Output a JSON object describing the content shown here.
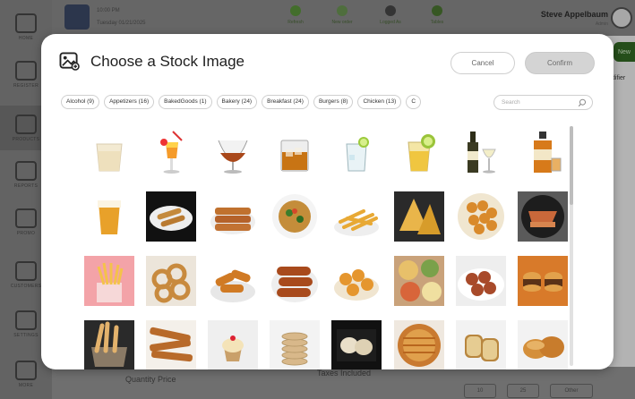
{
  "background": {
    "sidebar_items": [
      {
        "label": "HOME",
        "icon": "home-icon"
      },
      {
        "label": "REGISTER",
        "icon": "register-icon"
      },
      {
        "label": "PRODUCTS",
        "icon": "products-icon"
      },
      {
        "label": "REPORTS",
        "icon": "reports-icon"
      },
      {
        "label": "PROMO",
        "icon": "promo-icon"
      },
      {
        "label": "CUSTOMERS",
        "icon": "customers-icon"
      },
      {
        "label": "SETTINGS",
        "icon": "settings-icon"
      },
      {
        "label": "MORE",
        "icon": "more-icon"
      }
    ],
    "top_line_1": "10:00 PM",
    "top_line_2": "Tuesday 01/21/2025",
    "top_buttons": [
      {
        "label": "Refresh",
        "icon": "refresh-icon",
        "color": "#4e8a2e"
      },
      {
        "label": "New order",
        "icon": "new-order-icon",
        "color": "#5f8a46"
      },
      {
        "label": "Logged As",
        "icon": "user-icon",
        "color": "#3a3a3a"
      },
      {
        "label": "Tables",
        "icon": "tables-icon",
        "color": "#3d6a23"
      }
    ],
    "user_name": "Steve Appelbaum",
    "user_role": "Admin",
    "right_button": "New",
    "right_modifier": "difier",
    "quantity_price_label": "Quantity Price",
    "taxes_label": "Taxes Included",
    "bottom_pills": [
      "10",
      "25",
      "Other"
    ]
  },
  "modal": {
    "title": "Choose a Stock Image",
    "cancel_label": "Cancel",
    "confirm_label": "Confirm",
    "search_placeholder": "Search",
    "categories": [
      "Alcohol (9)",
      "Appetizers (16)",
      "BakedGoods (1)",
      "Bakery (24)",
      "Breakfast (24)",
      "Burgers (8)",
      "Chicken (13)",
      "C"
    ],
    "images": [
      {
        "name": "cocktail-milky",
        "row": "alcohol"
      },
      {
        "name": "cocktail-tropical",
        "row": "alcohol"
      },
      {
        "name": "brandy-snifter",
        "row": "alcohol"
      },
      {
        "name": "whiskey-rocks",
        "row": "alcohol"
      },
      {
        "name": "gin-tonic-lime",
        "row": "alcohol"
      },
      {
        "name": "tequila-shot",
        "row": "alcohol"
      },
      {
        "name": "wine-bottle-glass",
        "row": "alcohol"
      },
      {
        "name": "whiskey-bottle",
        "row": "alcohol"
      },
      {
        "name": "beer-glass",
        "row": "appetizers"
      },
      {
        "name": "spring-rolls",
        "row": "appetizers"
      },
      {
        "name": "mozzarella-sticks",
        "row": "appetizers"
      },
      {
        "name": "nachos-plate",
        "row": "appetizers"
      },
      {
        "name": "french-fries",
        "row": "appetizers"
      },
      {
        "name": "samosas",
        "row": "appetizers"
      },
      {
        "name": "fried-bites-plate",
        "row": "appetizers"
      },
      {
        "name": "meat-pan",
        "row": "appetizers"
      },
      {
        "name": "fries-pink-box",
        "row": "appetizers"
      },
      {
        "name": "onion-rings",
        "row": "appetizers"
      },
      {
        "name": "fried-chicken-fingers",
        "row": "appetizers"
      },
      {
        "name": "sausage-rolls",
        "row": "appetizers"
      },
      {
        "name": "fried-shrimp",
        "row": "appetizers"
      },
      {
        "name": "mixed-dishes",
        "row": "appetizers"
      },
      {
        "name": "meatballs",
        "row": "appetizers"
      },
      {
        "name": "sliders",
        "row": "appetizers"
      },
      {
        "name": "breadsticks-basket",
        "row": "bakery"
      },
      {
        "name": "cinnamon-sticks",
        "row": "bakery"
      },
      {
        "name": "cupcake",
        "row": "bakery"
      },
      {
        "name": "cookie-stack",
        "row": "bakery"
      },
      {
        "name": "cookies-black-tray",
        "row": "bakery"
      },
      {
        "name": "round-pie",
        "row": "bakery"
      },
      {
        "name": "bread-slices",
        "row": "bakery"
      },
      {
        "name": "bread-rolls",
        "row": "bakery"
      }
    ]
  }
}
